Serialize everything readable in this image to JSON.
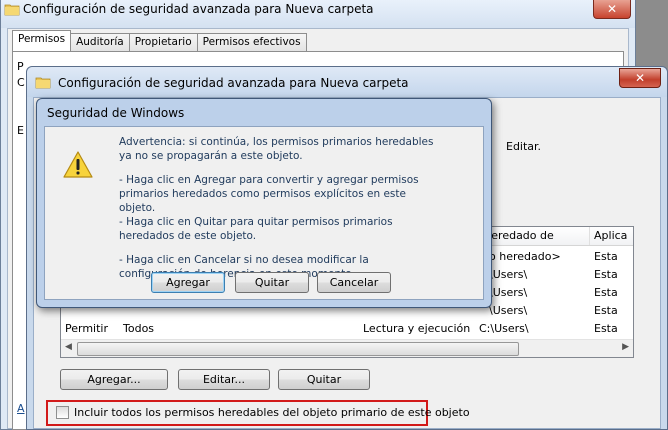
{
  "back_window": {
    "title": "Configuración de seguridad avanzada para Nueva carpeta",
    "tabs": [
      "Permisos",
      "Auditoría",
      "Propietario",
      "Permisos efectivos"
    ],
    "left_letters": [
      "P",
      "C",
      "E"
    ],
    "bottom_link_letter": "A"
  },
  "mid_window": {
    "title": "Configuración de seguridad avanzada para Nueva carpeta",
    "hint_fragment": "Editar.",
    "columns": [
      "Heredado de",
      "Aplica"
    ],
    "rows": [
      {
        "tipo": "",
        "nombre": "",
        "permiso": "",
        "heredado": "o heredado>",
        "aplica": "Esta"
      },
      {
        "tipo": "",
        "nombre": "",
        "permiso": "",
        "heredado": "\\Users\\",
        "aplica": "Esta"
      },
      {
        "tipo": "",
        "nombre": "",
        "permiso": "",
        "heredado": "\\Users\\",
        "aplica": "Esta"
      },
      {
        "tipo": "",
        "nombre": "",
        "permiso": "",
        "heredado": "\\Users\\",
        "aplica": "Esta"
      },
      {
        "tipo": "Permitir",
        "nombre": "Todos",
        "permiso": "Lectura y ejecución",
        "heredado": "C:\\Users\\",
        "aplica": "Esta"
      }
    ],
    "buttons": {
      "add": "Agregar...",
      "edit": "Editar...",
      "remove": "Quitar"
    },
    "checkbox_label": "Incluir todos los permisos heredables del objeto primario de este objeto",
    "checkbox_checked": false
  },
  "dialog": {
    "title": "Seguridad de Windows",
    "warning": "Advertencia: si continúa, los permisos primarios heredables ya no se propagarán a este objeto.",
    "bullets": [
      "- Haga clic en Agregar para convertir y agregar permisos primarios heredados como permisos explícitos en este objeto.",
      "- Haga clic en Quitar para quitar permisos primarios heredados de este objeto."
    ],
    "cancel_note": "- Haga clic en Cancelar si no desea modificar la configuración de herencia en este momento.",
    "buttons": {
      "add": "Agregar",
      "remove": "Quitar",
      "cancel": "Cancelar"
    }
  },
  "icons": {
    "folder": "folder-icon",
    "warning": "warning-icon",
    "close": "close-icon"
  },
  "colors": {
    "highlight_box": "#d21a1a",
    "dialog_text": "#1e395b"
  }
}
